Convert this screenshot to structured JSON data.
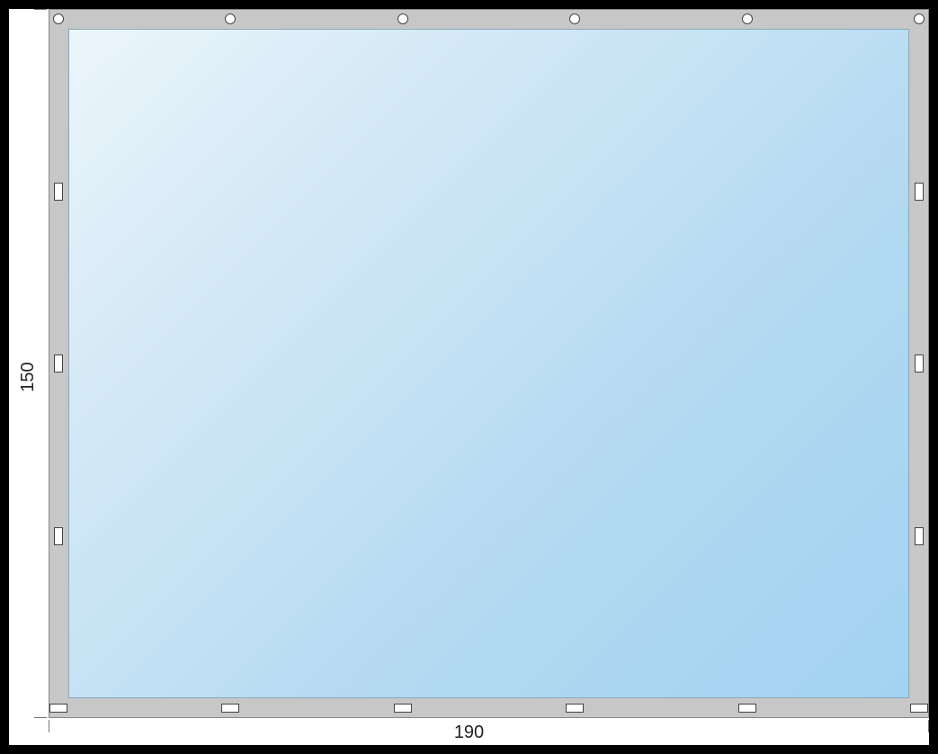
{
  "dimensions": {
    "width_label": "190",
    "height_label": "150"
  },
  "tarp": {
    "border_color": "#c7c7c7",
    "surface_gradient_start": "#ecf6fb",
    "surface_gradient_end": "#a2d3f1",
    "border_width_px": 22
  },
  "grommets": {
    "top": {
      "count": 6,
      "shape": "circle"
    },
    "bottom": {
      "count": 6,
      "shape": "rect-h"
    },
    "left": {
      "count": 3,
      "shape": "rect-v"
    },
    "right": {
      "count": 3,
      "shape": "rect-v"
    }
  }
}
